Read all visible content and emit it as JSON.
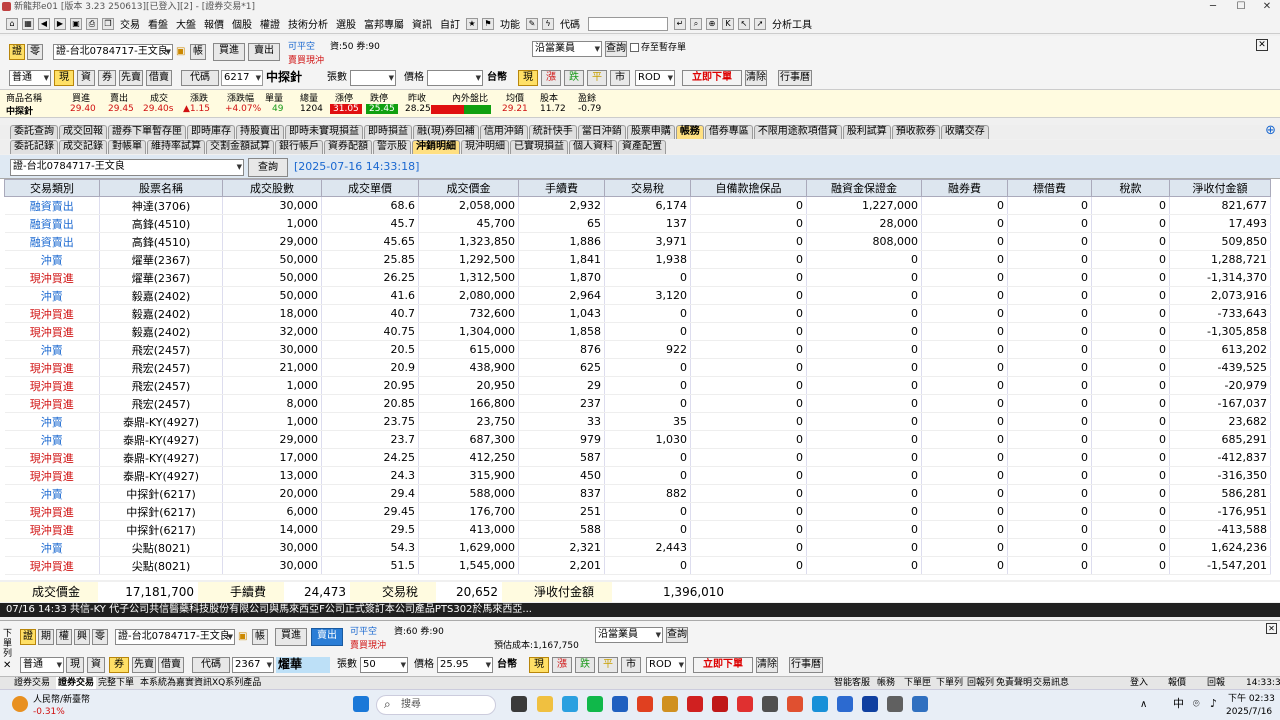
{
  "window": {
    "title": "新龍邦e01 [版本 3.23 250613][已登入][2] - [證券交易*1]"
  },
  "menu": [
    "交易",
    "看盤",
    "大盤",
    "報價",
    "個股",
    "權證",
    "技術分析",
    "選股",
    "富邦專屬",
    "資訊",
    "自訂",
    "功能",
    "代碼",
    "分析工具"
  ],
  "order": {
    "tab1": "證",
    "tab2": "零",
    "account": "證-台北0784717-王文良",
    "book_label": "帳",
    "buy": "買進",
    "sell": "賣出",
    "flag1": "可平空",
    "flag2": "賣買現沖",
    "info": "資:50 券:90",
    "trader": "沿當業員",
    "query": "查詢",
    "save_label": "存至暫存單",
    "type": "普通",
    "cash": "現",
    "fin": "資",
    "sec": "券",
    "first": "先賣",
    "lend": "借賣",
    "code_label": "代碼",
    "code": "6217",
    "stock_name": "中探針",
    "qty_label": "張數",
    "price_label": "價格",
    "ccy": "台幣",
    "p1": "現",
    "p2": "漲",
    "p3": "跌",
    "p4": "平",
    "p5": "市",
    "tif": "ROD",
    "submit": "立即下單",
    "clear": "清除",
    "cal": "行事曆"
  },
  "quote": {
    "headers": [
      "商品名稱",
      "買進",
      "賣出",
      "成交",
      "漲跌",
      "漲跌幅",
      "單量",
      "總量",
      "漲停",
      "跌停",
      "昨收",
      "內外盤比",
      "均價",
      "股本",
      "盈餘"
    ],
    "values": [
      "中探針",
      "29.40",
      "29.45",
      "29.40s",
      "▲1.15",
      "+4.07%",
      "49",
      "1204",
      "31.05",
      "25.45",
      "28.25",
      "",
      "29.21",
      "11.72",
      "-0.79"
    ]
  },
  "tabs1": [
    "委託查詢",
    "成交回報",
    "證券下單暫存匣",
    "即時庫存",
    "持股賣出",
    "即時未實現損益",
    "即時損益",
    "融(現)券回補",
    "信用沖銷",
    "統計快手",
    "當日沖銷",
    "股票申購",
    "帳務",
    "借券專區",
    "不限用途款項借貸",
    "股利試算",
    "預收款券",
    "收購交存"
  ],
  "tabs2": [
    "委託記錄",
    "成交記錄",
    "對帳單",
    "維持率試算",
    "交割金額試算",
    "銀行帳戶",
    "資券配額",
    "警示股",
    "沖銷明細",
    "現沖明細",
    "已實現損益",
    "個人資料",
    "資產配置"
  ],
  "acct": {
    "account": "證-台北0784717-王文良",
    "query": "查詢",
    "time": "[2025-07-16 14:33:18]"
  },
  "table": {
    "headers": [
      "交易類別",
      "股票名稱",
      "成交股數",
      "成交單價",
      "成交價金",
      "手續費",
      "交易稅",
      "自備款擔保品",
      "融資金保證金",
      "融券費",
      "標借費",
      "稅款",
      "淨收付金額"
    ],
    "rows": [
      [
        "融資賣出",
        "神達(3706)",
        "30,000",
        "68.6",
        "2,058,000",
        "2,932",
        "6,174",
        "0",
        "1,227,000",
        "0",
        "0",
        "0",
        "821,677"
      ],
      [
        "融資賣出",
        "高鋒(4510)",
        "1,000",
        "45.7",
        "45,700",
        "65",
        "137",
        "0",
        "28,000",
        "0",
        "0",
        "0",
        "17,493"
      ],
      [
        "融資賣出",
        "高鋒(4510)",
        "29,000",
        "45.65",
        "1,323,850",
        "1,886",
        "3,971",
        "0",
        "808,000",
        "0",
        "0",
        "0",
        "509,850"
      ],
      [
        "沖賣",
        "燿華(2367)",
        "50,000",
        "25.85",
        "1,292,500",
        "1,841",
        "1,938",
        "0",
        "0",
        "0",
        "0",
        "0",
        "1,288,721"
      ],
      [
        "現沖買進",
        "燿華(2367)",
        "50,000",
        "26.25",
        "1,312,500",
        "1,870",
        "0",
        "0",
        "0",
        "0",
        "0",
        "0",
        "-1,314,370"
      ],
      [
        "沖賣",
        "毅嘉(2402)",
        "50,000",
        "41.6",
        "2,080,000",
        "2,964",
        "3,120",
        "0",
        "0",
        "0",
        "0",
        "0",
        "2,073,916"
      ],
      [
        "現沖買進",
        "毅嘉(2402)",
        "18,000",
        "40.7",
        "732,600",
        "1,043",
        "0",
        "0",
        "0",
        "0",
        "0",
        "0",
        "-733,643"
      ],
      [
        "現沖買進",
        "毅嘉(2402)",
        "32,000",
        "40.75",
        "1,304,000",
        "1,858",
        "0",
        "0",
        "0",
        "0",
        "0",
        "0",
        "-1,305,858"
      ],
      [
        "沖賣",
        "飛宏(2457)",
        "30,000",
        "20.5",
        "615,000",
        "876",
        "922",
        "0",
        "0",
        "0",
        "0",
        "0",
        "613,202"
      ],
      [
        "現沖買進",
        "飛宏(2457)",
        "21,000",
        "20.9",
        "438,900",
        "625",
        "0",
        "0",
        "0",
        "0",
        "0",
        "0",
        "-439,525"
      ],
      [
        "現沖買進",
        "飛宏(2457)",
        "1,000",
        "20.95",
        "20,950",
        "29",
        "0",
        "0",
        "0",
        "0",
        "0",
        "0",
        "-20,979"
      ],
      [
        "現沖買進",
        "飛宏(2457)",
        "8,000",
        "20.85",
        "166,800",
        "237",
        "0",
        "0",
        "0",
        "0",
        "0",
        "0",
        "-167,037"
      ],
      [
        "沖賣",
        "泰鼎-KY(4927)",
        "1,000",
        "23.75",
        "23,750",
        "33",
        "35",
        "0",
        "0",
        "0",
        "0",
        "0",
        "23,682"
      ],
      [
        "沖賣",
        "泰鼎-KY(4927)",
        "29,000",
        "23.7",
        "687,300",
        "979",
        "1,030",
        "0",
        "0",
        "0",
        "0",
        "0",
        "685,291"
      ],
      [
        "現沖買進",
        "泰鼎-KY(4927)",
        "17,000",
        "24.25",
        "412,250",
        "587",
        "0",
        "0",
        "0",
        "0",
        "0",
        "0",
        "-412,837"
      ],
      [
        "現沖買進",
        "泰鼎-KY(4927)",
        "13,000",
        "24.3",
        "315,900",
        "450",
        "0",
        "0",
        "0",
        "0",
        "0",
        "0",
        "-316,350"
      ],
      [
        "沖賣",
        "中探針(6217)",
        "20,000",
        "29.4",
        "588,000",
        "837",
        "882",
        "0",
        "0",
        "0",
        "0",
        "0",
        "586,281"
      ],
      [
        "現沖買進",
        "中探針(6217)",
        "6,000",
        "29.45",
        "176,700",
        "251",
        "0",
        "0",
        "0",
        "0",
        "0",
        "0",
        "-176,951"
      ],
      [
        "現沖買進",
        "中探針(6217)",
        "14,000",
        "29.5",
        "413,000",
        "588",
        "0",
        "0",
        "0",
        "0",
        "0",
        "0",
        "-413,588"
      ],
      [
        "沖賣",
        "尖點(8021)",
        "30,000",
        "54.3",
        "1,629,000",
        "2,321",
        "2,443",
        "0",
        "0",
        "0",
        "0",
        "0",
        "1,624,236"
      ],
      [
        "現沖買進",
        "尖點(8021)",
        "30,000",
        "51.5",
        "1,545,000",
        "2,201",
        "0",
        "0",
        "0",
        "0",
        "0",
        "0",
        "-1,547,201"
      ]
    ]
  },
  "summary": {
    "k1": "成交價金",
    "v1": "17,181,700",
    "k2": "手續費",
    "v2": "24,473",
    "k3": "交易稅",
    "v3": "20,652",
    "k4": "淨收付金額",
    "v4": "1,396,010"
  },
  "news": "07/16 14:33    共信-KY 代子公司共信醫藥科技股份有限公司與馬來西亞F公司正式簽訂本公司產品PTS302於馬來西亞...",
  "bottom": {
    "side": "下單列",
    "t1": "證",
    "t2": "期",
    "t3": "權",
    "t4": "興",
    "t5": "零",
    "account": "證-台北0784717-王文良",
    "book": "帳",
    "buy": "買進",
    "sell": "賣出",
    "flag1": "可平空",
    "flag2": "賣買現沖",
    "info": "資:60 券:90",
    "cost": "預估成本:1,167,750",
    "trader": "沿當業員",
    "query": "查詢",
    "type": "普通",
    "cash": "現",
    "fin": "資",
    "sec": "券",
    "first": "先賣",
    "lend": "借賣",
    "code_label": "代碼",
    "code": "2367",
    "stock_name": "燿華",
    "qty_label": "張數",
    "qty": "50",
    "price_label": "價格",
    "price": "25.95",
    "ccy": "台幣",
    "p1": "現",
    "p2": "漲",
    "p3": "跌",
    "p4": "平",
    "p5": "市",
    "tif": "ROD",
    "submit": "立即下單",
    "clear": "清除",
    "cal": "行事曆"
  },
  "status": {
    "left": [
      "證券交易",
      "證券交易",
      "完整下單",
      "本系統為嘉實資訊XQ系列產品"
    ],
    "right": [
      "智能客服",
      "帳務",
      "下單匣",
      "下單列",
      "回報列",
      "免責聲明",
      "交易訊息",
      "登入",
      "報價",
      "回報",
      "14:33:33"
    ]
  },
  "taskbar": {
    "weather1": "人民幣/新臺幣",
    "weather2": "-0.31%",
    "search": "搜尋",
    "lang": "中",
    "time": "下午 02:33",
    "date": "2025/7/16"
  }
}
